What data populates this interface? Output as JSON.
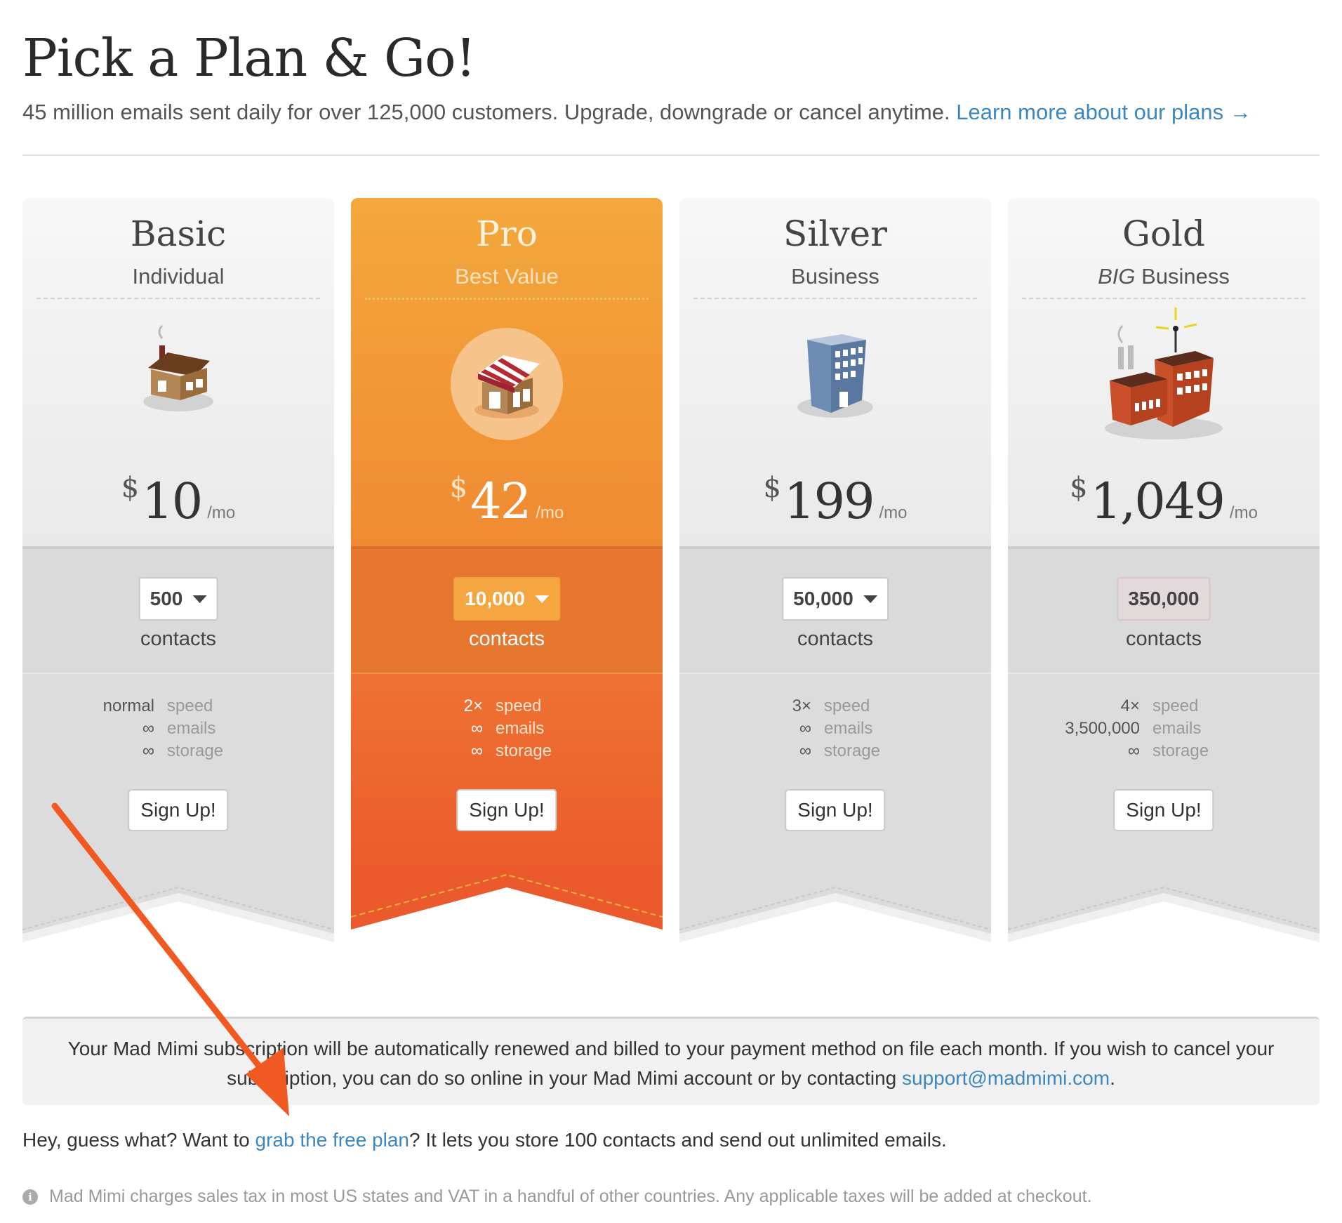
{
  "page": {
    "title": "Pick a Plan & Go!",
    "subtitle_text": "45 million emails sent daily for over 125,000 customers. Upgrade, downgrade or cancel anytime.",
    "learn_more_link": "Learn more about our plans →"
  },
  "plans": [
    {
      "name": "Basic",
      "tagline": "Individual",
      "icon": "house-icon",
      "currency": "$",
      "price": "10",
      "period": "/mo",
      "contacts_value": "500",
      "contacts_label": "contacts",
      "features": [
        {
          "value": "normal",
          "label": "speed"
        },
        {
          "value": "∞",
          "label": "emails"
        },
        {
          "value": "∞",
          "label": "storage"
        }
      ],
      "signup_label": "Sign Up!"
    },
    {
      "name": "Pro",
      "tagline": "Best Value",
      "icon": "shop-icon",
      "currency": "$",
      "price": "42",
      "period": "/mo",
      "contacts_value": "10,000",
      "contacts_label": "contacts",
      "features": [
        {
          "value": "2×",
          "label": "speed"
        },
        {
          "value": "∞",
          "label": "emails"
        },
        {
          "value": "∞",
          "label": "storage"
        }
      ],
      "signup_label": "Sign Up!"
    },
    {
      "name": "Silver",
      "tagline": "Business",
      "icon": "office-building-icon",
      "currency": "$",
      "price": "199",
      "period": "/mo",
      "contacts_value": "50,000",
      "contacts_label": "contacts",
      "features": [
        {
          "value": "3×",
          "label": "speed"
        },
        {
          "value": "∞",
          "label": "emails"
        },
        {
          "value": "∞",
          "label": "storage"
        }
      ],
      "signup_label": "Sign Up!"
    },
    {
      "name": "Gold",
      "tagline_em": "BIG",
      "tagline": "Business",
      "icon": "factory-icon",
      "currency": "$",
      "price": "1,049",
      "period": "/mo",
      "contacts_value": "350,000",
      "contacts_label": "contacts",
      "features": [
        {
          "value": "4×",
          "label": "speed"
        },
        {
          "value": "3,500,000",
          "label": "emails"
        },
        {
          "value": "∞",
          "label": "storage"
        }
      ],
      "signup_label": "Sign Up!"
    }
  ],
  "notice": {
    "text": "Your Mad Mimi subscription will be automatically renewed and billed to your payment method on file each month. If you wish to cancel your subscription, you can do so online in your Mad Mimi account or by contacting",
    "email_link": "support@madmimi.com",
    "end": "."
  },
  "free_plan": {
    "before": "Hey, guess what? Want to",
    "link": "grab the free plan",
    "after": "? It lets you store 100 contacts and send out unlimited emails."
  },
  "tax_note": "Mad Mimi charges sales tax in most US states and VAT in a handful of other countries. Any applicable taxes will be added at checkout.",
  "colors": {
    "accent_orange": "#f08a32",
    "link_blue": "#3b87bf",
    "annotation_arrow": "#f05a22"
  }
}
